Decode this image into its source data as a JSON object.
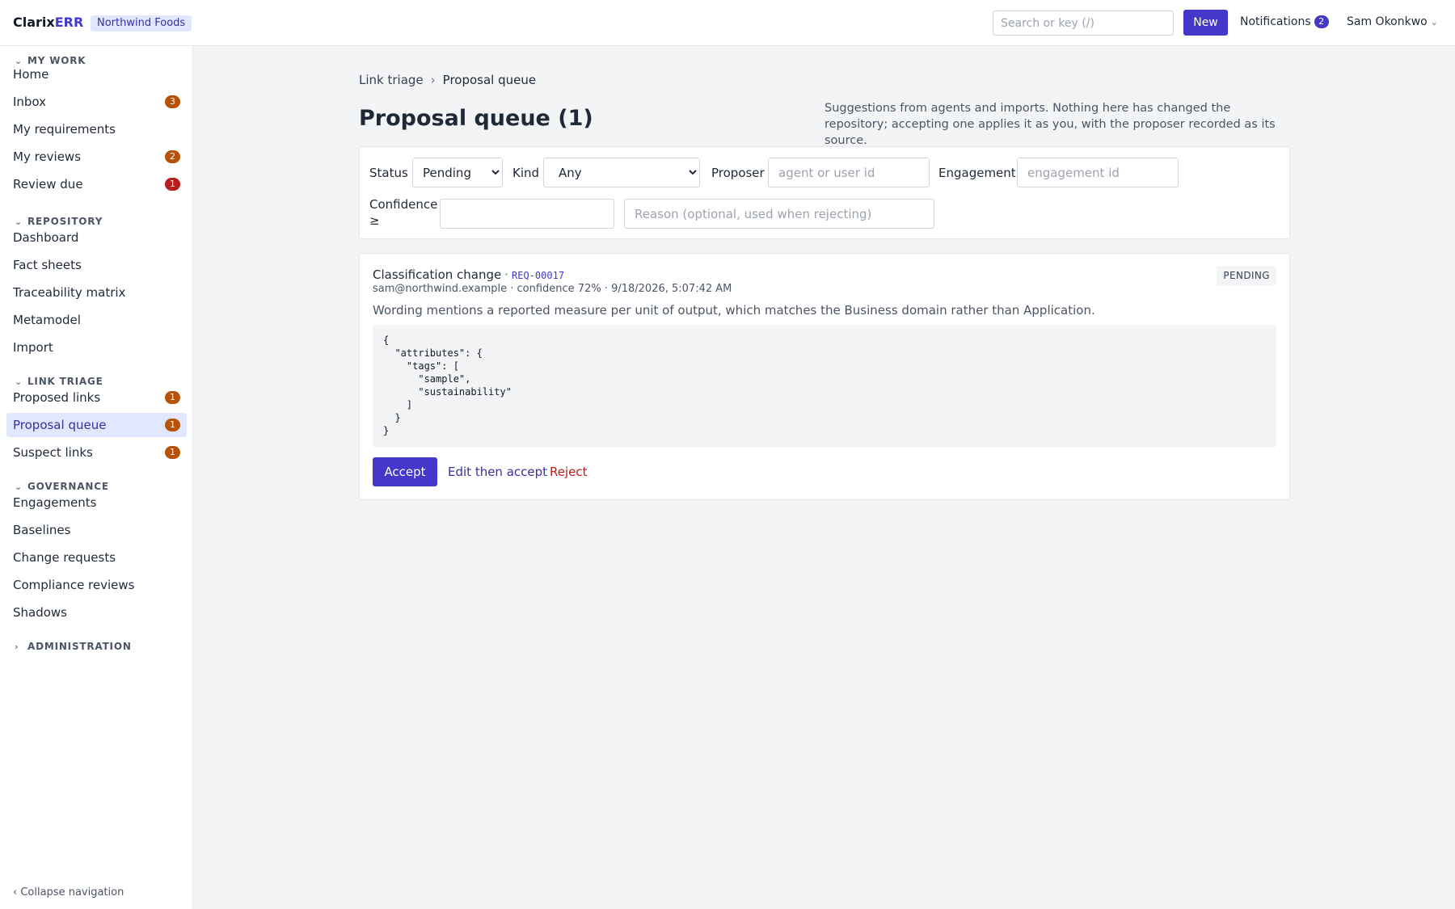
{
  "app": {
    "brand_main": "Clarix",
    "brand_accent": "ERR",
    "org": "Northwind Foods"
  },
  "topbar": {
    "search_placeholder": "Search or key (/)",
    "new_label": "New",
    "notifications_label": "Notifications",
    "notifications_count": "2",
    "user_name": "Sam Okonkwo",
    "user_chevron": "⌄"
  },
  "sidebar": {
    "sections": [
      {
        "title": "MY WORK",
        "caret": "⌄"
      },
      {
        "title": "REPOSITORY",
        "caret": "⌄"
      },
      {
        "title": "LINK TRIAGE",
        "caret": "⌄"
      },
      {
        "title": "GOVERNANCE",
        "caret": "⌄"
      },
      {
        "title": "ADMINISTRATION",
        "caret": "›"
      }
    ],
    "items": [
      {
        "label": "Home"
      },
      {
        "label": "Inbox",
        "badge": "3",
        "badge_color": "#b45309"
      },
      {
        "label": "My requirements"
      },
      {
        "label": "My reviews",
        "badge": "2",
        "badge_color": "#b45309"
      },
      {
        "label": "Review due",
        "badge": "1",
        "badge_color": "#b91c1c"
      },
      {
        "label": "Dashboard"
      },
      {
        "label": "Fact sheets"
      },
      {
        "label": "Traceability matrix"
      },
      {
        "label": "Metamodel"
      },
      {
        "label": "Import"
      },
      {
        "label": "Proposed links",
        "badge": "1",
        "badge_color": "#b45309"
      },
      {
        "label": "Proposal queue",
        "badge": "1",
        "badge_color": "#b45309",
        "active": true
      },
      {
        "label": "Suspect links",
        "badge": "1",
        "badge_color": "#b45309"
      },
      {
        "label": "Engagements"
      },
      {
        "label": "Baselines"
      },
      {
        "label": "Change requests"
      },
      {
        "label": "Compliance reviews"
      },
      {
        "label": "Shadows"
      }
    ],
    "collapse_label": "‹ Collapse navigation"
  },
  "breadcrumb": {
    "parent": "Link triage",
    "separator": "›",
    "current": "Proposal queue"
  },
  "page": {
    "title": "Proposal queue (1)",
    "description": "Suggestions from agents and imports. Nothing here has changed the repository; accepting one applies it as you, with the proposer recorded as its source."
  },
  "filters": {
    "status_label": "Status",
    "status_value": "Pending",
    "kind_label": "Kind",
    "kind_value": "Any",
    "proposer_label": "Proposer",
    "proposer_placeholder": "agent or user id",
    "engagement_label": "Engagement",
    "engagement_placeholder": "engagement id",
    "confidence_label_1": "Confidence",
    "confidence_label_2": "≥",
    "confidence_value": "",
    "reason_placeholder": "Reason (optional, used when rejecting)"
  },
  "proposal": {
    "kind": "Classification change",
    "separator": "·",
    "key": "REQ-00017",
    "status": "PENDING",
    "meta": "sam@northwind.example · confidence 72% · 9/18/2026, 5:07:42 AM",
    "reason": "Wording mentions a reported measure per unit of output, which matches the Business domain rather than Application.",
    "payload": "{\n  \"attributes\": {\n    \"tags\": [\n      \"sample\",\n      \"sustainability\"\n    ]\n  }\n}",
    "accept_label": "Accept",
    "edit_label": "Edit then accept",
    "reject_label": "Reject"
  }
}
